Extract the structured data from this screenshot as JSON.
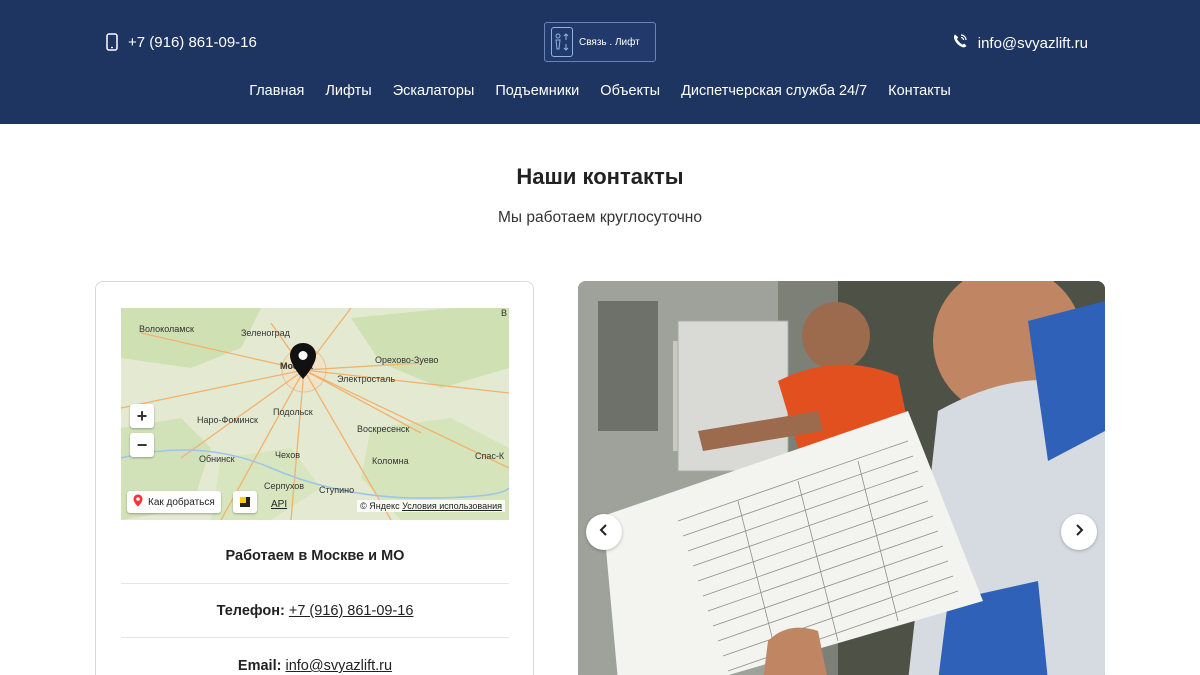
{
  "header": {
    "phone": "+7 (916) 861-09-16",
    "email": "info@svyazlift.ru",
    "logo_text": "Связь . Лифт",
    "bg_color": "#1e3461"
  },
  "nav": {
    "items": [
      {
        "label": "Главная"
      },
      {
        "label": "Лифты"
      },
      {
        "label": "Эскалаторы"
      },
      {
        "label": "Подъемники"
      },
      {
        "label": "Объекты"
      },
      {
        "label": "Диспетчерская служба 24/7"
      },
      {
        "label": "Контакты"
      }
    ]
  },
  "main": {
    "title": "Наши контакты",
    "subtitle": "Мы работаем круглосуточно"
  },
  "map": {
    "cities": {
      "volokolamsk": "Волоколамск",
      "zelenograd": "Зеленоград",
      "moscow": "Москва",
      "orekhovo": "Орехово-Зуево",
      "elektrostal": "Электросталь",
      "naro": "Наро-Фоминск",
      "podolsk": "Подольск",
      "voskresensk": "Воскресенск",
      "obninsk": "Обнинск",
      "chekhov": "Чехов",
      "kolomna": "Коломна",
      "spas": "Спас-К",
      "serpukhov": "Серпухов",
      "stupino": "Ступино",
      "edge": "В"
    },
    "zoom_in": "+",
    "zoom_out": "−",
    "route_label": "Как добраться",
    "api_label": "API",
    "copyright": "© Яндекс",
    "terms": "Условия использования"
  },
  "contacts": {
    "region": "Работаем в Москве и МО",
    "phone_label": "Телефон:",
    "phone": "+7 (916) 861-09-16",
    "email_label": "Email:",
    "email": "info@svyazlift.ru"
  },
  "slider": {
    "prev_icon": "chevron-left-icon",
    "next_icon": "chevron-right-icon"
  }
}
